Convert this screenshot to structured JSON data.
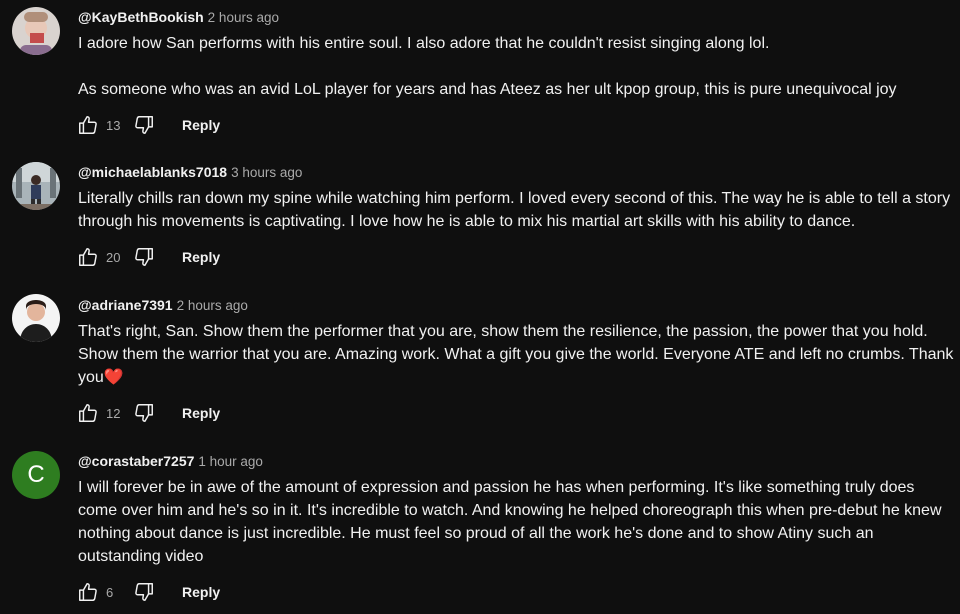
{
  "comments": [
    {
      "handle": "@KayBethBookish",
      "time": "2 hours ago",
      "paragraphs": [
        "I adore how San performs with his entire soul. I also adore that he couldn't resist singing along lol.",
        "As someone who was an avid LoL player for years and has Ateez as her ult kpop group, this is pure unequivocal joy"
      ],
      "likes": "13",
      "reply_label": "Reply"
    },
    {
      "handle": "@michaelablanks7018",
      "time": "3 hours ago",
      "text": "Literally chills ran down my spine while watching him perform. I loved every second of this. The way he is able to tell a story through his movements is captivating. I love how he is able to mix his martial art skills with his ability to dance.",
      "likes": "20",
      "reply_label": "Reply"
    },
    {
      "handle": "@adriane7391",
      "time": "2 hours ago",
      "text": "That's right, San. Show them the performer that you are, show them the resilience, the passion, the power that you hold. Show them the warrior that you are. Amazing work. What a gift you give the world. Everyone ATE and left no crumbs. Thank you",
      "emoji": "❤️",
      "likes": "12",
      "reply_label": "Reply"
    },
    {
      "handle": "@corastaber7257",
      "time": "1 hour ago",
      "avatar_letter": "C",
      "avatar_color": "#2e7d20",
      "text": "I will forever be in awe of the amount of expression and passion he has when performing. It's like something truly does come over him and he's so in it. It's incredible to watch. And knowing he helped choreograph this when pre-debut he knew nothing about dance is just incredible. He must feel so proud of all the work he's done and to show Atiny such an outstanding video",
      "likes": "6",
      "reply_label": "Reply"
    }
  ],
  "icons": {
    "like": "thumbs-up-icon",
    "dislike": "thumbs-down-icon"
  }
}
